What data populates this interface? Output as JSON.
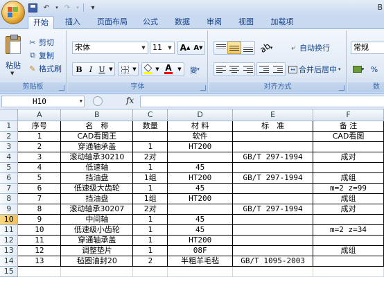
{
  "window": {
    "title_right": "B"
  },
  "quick_access": {
    "undo": "↶",
    "redo": "↷",
    "customize": "▾"
  },
  "tabs": [
    {
      "label": "开始",
      "active": true
    },
    {
      "label": "插入"
    },
    {
      "label": "页面布局"
    },
    {
      "label": "公式"
    },
    {
      "label": "数据"
    },
    {
      "label": "审阅"
    },
    {
      "label": "视图"
    },
    {
      "label": "加载项"
    }
  ],
  "clipboard": {
    "paste": "粘贴",
    "cut": "剪切",
    "copy": "复制",
    "format_painter": "格式刷",
    "group_label": "剪贴板"
  },
  "font": {
    "name": "宋体",
    "size": "11",
    "grow": "A",
    "shrink": "A",
    "bold": "B",
    "italic": "I",
    "underline": "U",
    "font_color_letter": "A",
    "phonetic": "變",
    "group_label": "字体"
  },
  "alignment": {
    "wrap_text": "自动换行",
    "merge_center": "合并后居中",
    "group_label": "对齐方式"
  },
  "number": {
    "format": "常规",
    "percent": "%",
    "group_label": "数"
  },
  "formula_bar": {
    "name_box": "H10",
    "fx": "fx",
    "formula": ""
  },
  "colors": {
    "ribbon_text": "#15428b",
    "selected_header": "#f1c15f",
    "grid_line": "#d0d7e5"
  },
  "sheet": {
    "selected_cell": "H10",
    "columns": [
      "A",
      "B",
      "C",
      "D",
      "E",
      "F"
    ],
    "rows": [
      {
        "n": "1",
        "cells": [
          "序号",
          "名　称",
          "数量",
          "材 料",
          "标　准",
          "备 注"
        ]
      },
      {
        "n": "2",
        "cells": [
          "1",
          "CAD看图王",
          "",
          "软件",
          "",
          "CAD看图"
        ]
      },
      {
        "n": "3",
        "cells": [
          "2",
          "穿通轴承盖",
          "1",
          "HT200",
          "",
          ""
        ]
      },
      {
        "n": "4",
        "cells": [
          "3",
          "滚动轴承30210",
          "2对",
          "",
          "GB/T 297-1994",
          "成对"
        ]
      },
      {
        "n": "5",
        "cells": [
          "4",
          "低速轴",
          "1",
          "45",
          "",
          ""
        ]
      },
      {
        "n": "6",
        "cells": [
          "5",
          "挡油盘",
          "1组",
          "HT200",
          "GB/T 297-1994",
          "成组"
        ]
      },
      {
        "n": "7",
        "cells": [
          "6",
          "低速级大齿轮",
          "1",
          "45",
          "",
          "m=2 z=99"
        ]
      },
      {
        "n": "8",
        "cells": [
          "7",
          "挡油盘",
          "1组",
          "HT200",
          "",
          "成组"
        ]
      },
      {
        "n": "9",
        "cells": [
          "8",
          "滚动轴承30207",
          "2对",
          "",
          "GB/T 297-1994",
          "成对"
        ]
      },
      {
        "n": "10",
        "cells": [
          "9",
          "中间轴",
          "1",
          "45",
          "",
          ""
        ]
      },
      {
        "n": "11",
        "cells": [
          "10",
          "低速级小齿轮",
          "1",
          "45",
          "",
          "m=2 z=34"
        ]
      },
      {
        "n": "12",
        "cells": [
          "11",
          "穿通轴承盖",
          "1",
          "HT200",
          "",
          ""
        ]
      },
      {
        "n": "13",
        "cells": [
          "12",
          "调整垫片",
          "1",
          "08F",
          "",
          "成组"
        ]
      },
      {
        "n": "14",
        "cells": [
          "13",
          "毡圈油封20",
          "2",
          "半粗羊毛毡",
          "GB/T 1095-2003",
          ""
        ]
      },
      {
        "n": "15",
        "cells": [
          "",
          "",
          "",
          "",
          "",
          ""
        ]
      }
    ]
  }
}
